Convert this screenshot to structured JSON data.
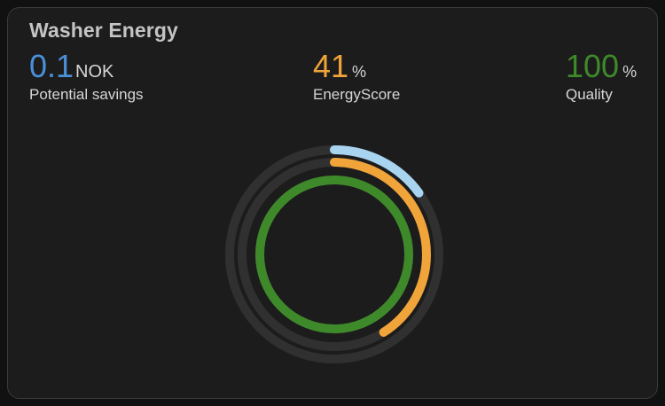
{
  "card": {
    "title": "Washer Energy"
  },
  "metrics": {
    "savings": {
      "value": "0.1",
      "unit": "NOK",
      "label": "Potential savings",
      "color": "#4a90d9"
    },
    "energy_score": {
      "value": "41",
      "unit": "%",
      "label": "EnergyScore",
      "color": "#f0a43a"
    },
    "quality": {
      "value": "100",
      "unit": "%",
      "label": "Quality",
      "color": "#3e8a2a"
    }
  },
  "rings": [
    {
      "name": "savings",
      "fraction": 0.15,
      "color": "#a8d4f0",
      "track_color": "#303030"
    },
    {
      "name": "energy_score",
      "fraction": 0.41,
      "color": "#f0a43a",
      "track_color": "#303030"
    },
    {
      "name": "quality",
      "fraction": 1.0,
      "color": "#3e8a2a",
      "track_color": "#303030"
    }
  ]
}
